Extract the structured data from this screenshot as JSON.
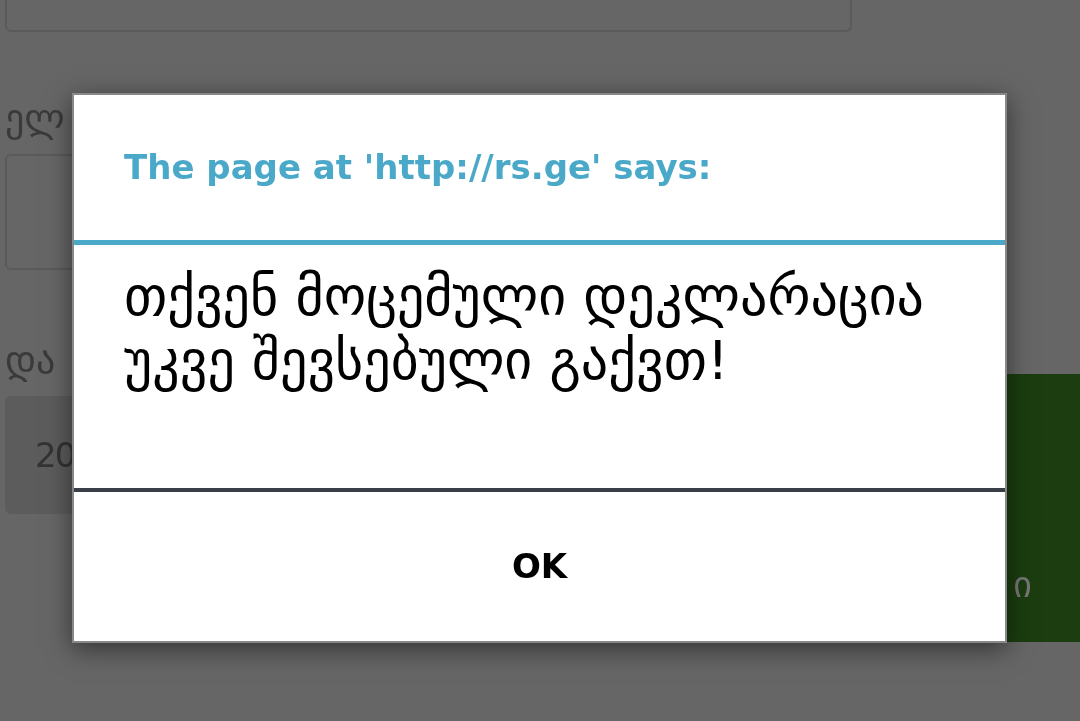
{
  "page": {
    "label_1": "ელ",
    "label_2": "და",
    "field_value": "20",
    "button_label": "ი"
  },
  "dialog": {
    "title": "The page at 'http://rs.ge' says:",
    "message": "თქვენ მოცემული დეკლარაცია უკვე შევსებული გაქვთ!",
    "button": "OK"
  }
}
